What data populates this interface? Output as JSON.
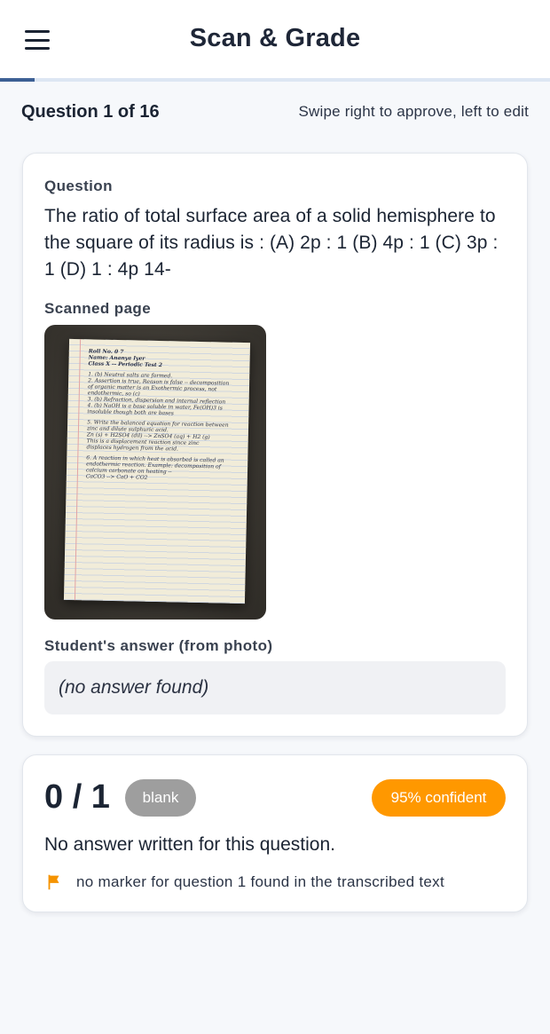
{
  "app": {
    "title": "Scan & Grade"
  },
  "progress": {
    "fraction": 0.0625
  },
  "question_header": {
    "counter": "Question 1 of 16",
    "hint": "Swipe right to approve, left to edit"
  },
  "question_card": {
    "question_label": "Question",
    "question_text": "The ratio of total surface area of a solid hemisphere to the square of its radius is : (A) 2p : 1 (B) 4p : 1 (C) 3p : 1 (D) 1 : 4p 14-",
    "scan_label": "Scanned page",
    "scan_lines": [
      "Roll No.  0  7",
      "Name:   Ananya Iyer",
      "Class X -- Periodic Test 2",
      "",
      "1. (b) Neutral salts are formed.",
      "2. Assertion is true, Reason is false -- decomposition",
      "of organic matter is an Exothermic process, not",
      "endothermic, so (c)",
      "3. (b) Refraction, dispersion and internal reflection",
      "4. (b) NaOH is a base soluble in water, Fe(OH)3 is",
      "insoluble though both are bases",
      "",
      "5. Write the balanced equation for reaction between",
      "zinc and dilute sulphuric acid.",
      "Zn (s) + H2SO4 (dil) --> ZnSO4 (aq) + H2 (g)",
      "This is a displacement reaction since zinc",
      "displaces hydrogen from the acid.",
      "",
      "6. A reaction in which heat is absorbed is called an",
      "endothermic reaction. Example: decomposition of",
      "calcium carbonate on heating --",
      "CaCO3 --> CaO + CO2"
    ],
    "answer_label": "Student's answer (from photo)",
    "answer_text": "(no answer found)"
  },
  "result_card": {
    "score": "0 / 1",
    "status_badge": "blank",
    "confidence_badge": "95% confident",
    "feedback": "No answer written for this question.",
    "flag_note": "no marker for question 1 found in the transcribed text"
  },
  "colors": {
    "accent": "#3c5f94",
    "blank_badge": "#9e9e9e",
    "confidence_badge": "#ff9800",
    "flag": "#f59300"
  },
  "icons": {
    "menu": "hamburger-menu-icon",
    "flag": "flag-icon"
  }
}
